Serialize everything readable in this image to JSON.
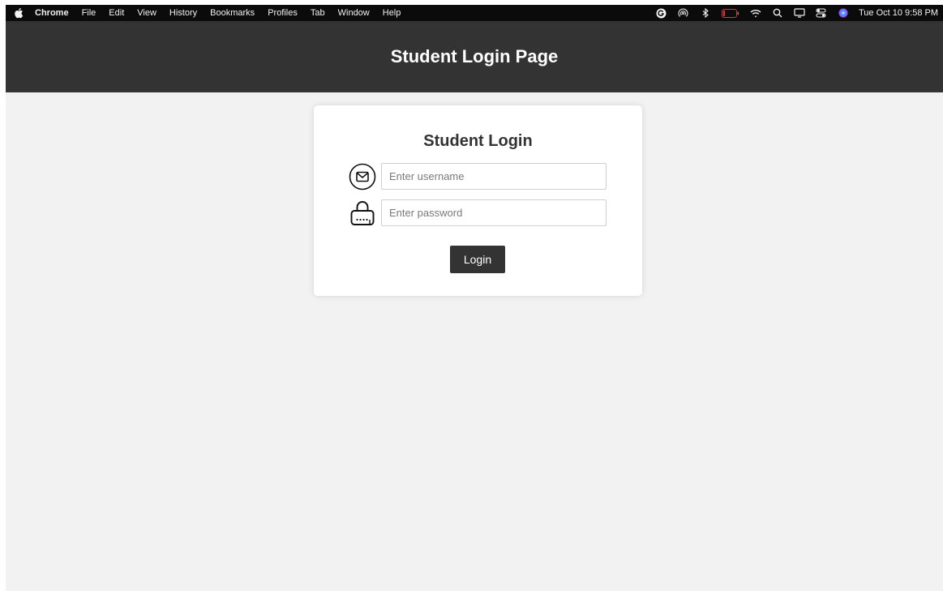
{
  "menubar": {
    "app_name": "Chrome",
    "items": [
      "File",
      "Edit",
      "View",
      "History",
      "Bookmarks",
      "Profiles",
      "Tab",
      "Window",
      "Help"
    ],
    "status_icons": [
      "grammarly-icon",
      "airdrop-icon",
      "bluetooth-icon",
      "battery-icon",
      "wifi-icon",
      "spotlight-search-icon",
      "screen-mirroring-icon",
      "control-center-icon",
      "siri-icon"
    ],
    "clock": "Tue Oct 10  9:58 PM"
  },
  "header": {
    "title": "Student Login Page"
  },
  "login": {
    "title": "Student Login",
    "username_placeholder": "Enter username",
    "password_placeholder": "Enter password",
    "button_label": "Login"
  },
  "colors": {
    "header_bg": "#333333",
    "page_bg": "#f2f2f2",
    "card_bg": "#ffffff",
    "button_bg": "#333333"
  }
}
